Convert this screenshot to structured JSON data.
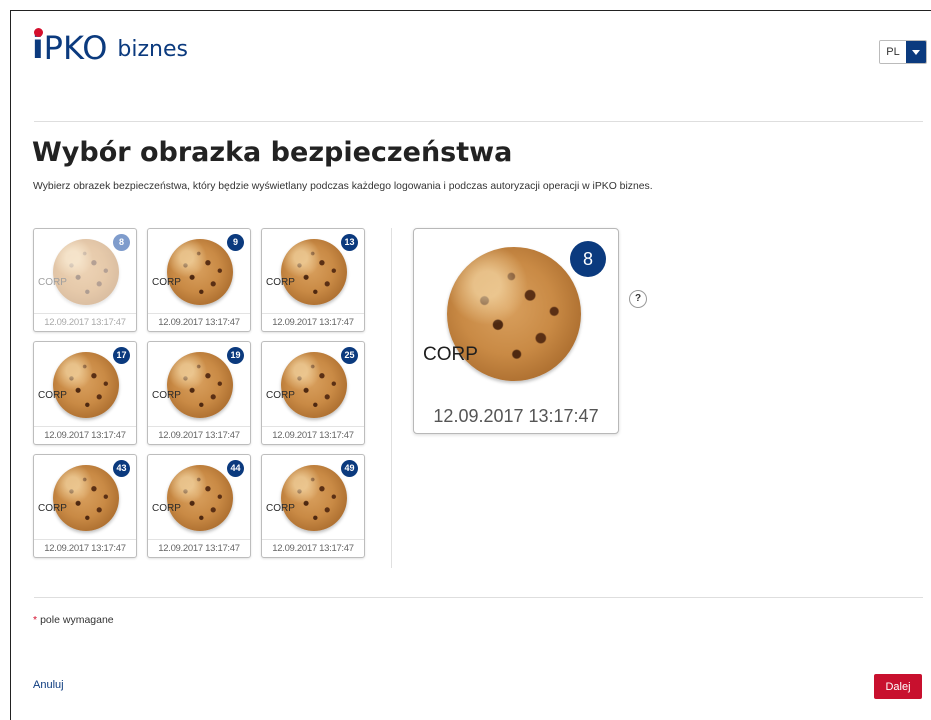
{
  "header": {
    "logo": {
      "i": "i",
      "pko": "PKO",
      "biznes": "biznes"
    },
    "language": "PL"
  },
  "page": {
    "title": "Wybór obrazka bezpieczeństwa",
    "description": "Wybierz obrazek bezpieczeństwa, który będzie wyświetlany podczas każdego logowania i podczas autoryzacji operacji w iPKO biznes."
  },
  "images": [
    {
      "number": "8",
      "label": "CORP",
      "date": "12.09.2017 13:17:47",
      "selected": true
    },
    {
      "number": "9",
      "label": "CORP",
      "date": "12.09.2017 13:17:47"
    },
    {
      "number": "13",
      "label": "CORP",
      "date": "12.09.2017 13:17:47"
    },
    {
      "number": "17",
      "label": "CORP",
      "date": "12.09.2017 13:17:47"
    },
    {
      "number": "19",
      "label": "CORP",
      "date": "12.09.2017 13:17:47"
    },
    {
      "number": "25",
      "label": "CORP",
      "date": "12.09.2017 13:17:47"
    },
    {
      "number": "43",
      "label": "CORP",
      "date": "12.09.2017 13:17:47"
    },
    {
      "number": "44",
      "label": "CORP",
      "date": "12.09.2017 13:17:47"
    },
    {
      "number": "49",
      "label": "CORP",
      "date": "12.09.2017 13:17:47"
    }
  ],
  "preview": {
    "number": "8",
    "label": "CORP",
    "date": "12.09.2017 13:17:47"
  },
  "help": "?",
  "footer": {
    "required_star": "*",
    "required_text": "pole wymagane",
    "cancel": "Anuluj",
    "next": "Dalej"
  },
  "colors": {
    "brand": "#0b3a7e",
    "accent": "#c8102e"
  }
}
